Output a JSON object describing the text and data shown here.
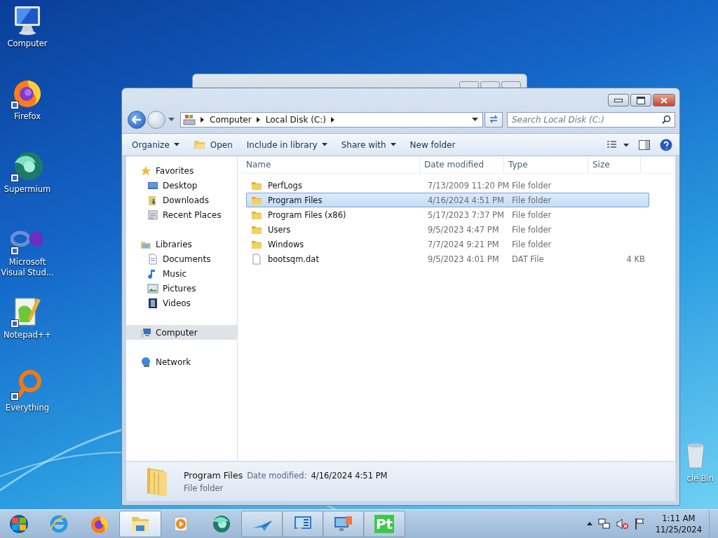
{
  "desktop_icons": [
    {
      "label": "Computer",
      "kind": "computer",
      "shortcut": false
    },
    {
      "label": "Firefox",
      "kind": "firefox",
      "shortcut": true
    },
    {
      "label": "Supermium",
      "kind": "supermium",
      "shortcut": true
    },
    {
      "label": "Microsoft Visual Stud...",
      "kind": "visual-studio",
      "shortcut": true
    },
    {
      "label": "Notepad++",
      "kind": "notepad",
      "shortcut": true
    },
    {
      "label": "Everything",
      "kind": "everything",
      "shortcut": true
    }
  ],
  "recycle_bin": {
    "label": "cle Bin"
  },
  "explorer": {
    "breadcrumb": [
      "Computer",
      "Local Disk (C:)"
    ],
    "search": {
      "placeholder": "Search Local Disk (C:)"
    },
    "toolbar": [
      {
        "label": "Organize",
        "kind": "menu"
      },
      {
        "label": "Open",
        "kind": "open"
      },
      {
        "label": "Include in library",
        "kind": "menu"
      },
      {
        "label": "Share with",
        "kind": "menu"
      },
      {
        "label": "New folder",
        "kind": "plain"
      }
    ],
    "nav": [
      {
        "label": "Favorites",
        "kind": "star",
        "selected": false,
        "children": [
          {
            "label": "Desktop",
            "kind": "desktop",
            "selected": false
          },
          {
            "label": "Downloads",
            "kind": "downloads",
            "selected": false
          },
          {
            "label": "Recent Places",
            "kind": "recent",
            "selected": false
          }
        ]
      },
      {
        "label": "Libraries",
        "kind": "library",
        "selected": false,
        "children": [
          {
            "label": "Documents",
            "kind": "document",
            "selected": false
          },
          {
            "label": "Music",
            "kind": "music",
            "selected": false
          },
          {
            "label": "Pictures",
            "kind": "pictures",
            "selected": false
          },
          {
            "label": "Videos",
            "kind": "videos",
            "selected": false
          }
        ]
      },
      {
        "label": "Computer",
        "kind": "computer",
        "selected": true
      },
      {
        "label": "Network",
        "kind": "network",
        "selected": false
      }
    ],
    "columns": [
      "Name",
      "Date modified",
      "Type",
      "Size"
    ],
    "rows": [
      {
        "name": "PerfLogs",
        "date": "7/13/2009 11:20 PM",
        "type": "File folder",
        "size": "",
        "kind": "folder",
        "selected": false
      },
      {
        "name": "Program Files",
        "date": "4/16/2024 4:51 PM",
        "type": "File folder",
        "size": "",
        "kind": "folder",
        "selected": true
      },
      {
        "name": "Program Files (x86)",
        "date": "5/17/2023 7:37 PM",
        "type": "File folder",
        "size": "",
        "kind": "folder",
        "selected": false
      },
      {
        "name": "Users",
        "date": "9/5/2023 4:47 PM",
        "type": "File folder",
        "size": "",
        "kind": "folder",
        "selected": false
      },
      {
        "name": "Windows",
        "date": "7/7/2024 9:21 PM",
        "type": "File folder",
        "size": "",
        "kind": "folder",
        "selected": false
      },
      {
        "name": "bootsqm.dat",
        "date": "9/5/2023 4:01 PM",
        "type": "DAT File",
        "size": "4 KB",
        "kind": "file",
        "selected": false
      }
    ],
    "details": {
      "name": "Program Files",
      "date_label": "Date modified:",
      "date": "4/16/2024 4:51 PM",
      "type": "File folder"
    }
  },
  "taskbar": {
    "items": [
      {
        "kind": "ie",
        "open": false,
        "selected": false
      },
      {
        "kind": "firefox",
        "open": false,
        "selected": false
      },
      {
        "kind": "explorer",
        "open": true,
        "selected": true
      },
      {
        "kind": "media",
        "open": false,
        "selected": false
      },
      {
        "kind": "supermium",
        "open": false,
        "selected": false
      },
      {
        "kind": "plane",
        "open": true,
        "selected": false
      },
      {
        "kind": "control",
        "open": true,
        "selected": false
      },
      {
        "kind": "monitor",
        "open": true,
        "selected": false
      },
      {
        "kind": "pt",
        "open": true,
        "selected": false,
        "label": "Pt"
      }
    ],
    "clock": {
      "time": "1:11 AM",
      "date": "11/25/2024"
    }
  }
}
